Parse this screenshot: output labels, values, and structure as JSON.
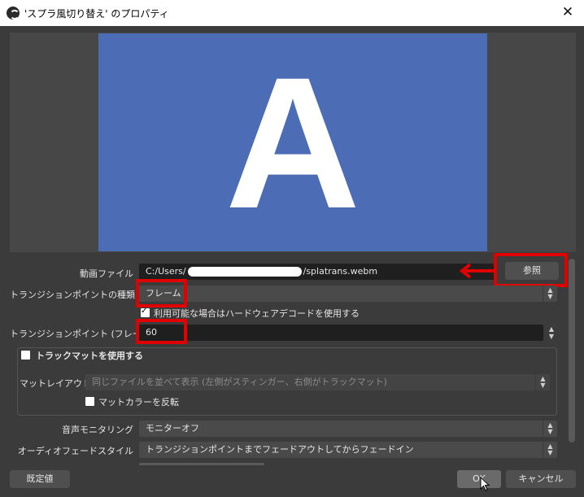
{
  "window": {
    "title": "'スプラ風切り替え' のプロパティ",
    "close_glyph": "✕"
  },
  "preview": {
    "letter": "A",
    "bg_color": "#4c6db5"
  },
  "fields": {
    "video_file_label": "動画ファイル",
    "video_file_prefix": "C:/Users/",
    "video_file_suffix": "/splatrans.webm",
    "browse_label": "参照",
    "transition_point_type_label": "トランジションポイントの種類",
    "transition_point_type_value": "フレーム",
    "hw_decode_label": "利用可能な場合はハードウェアデコードを使用する",
    "hw_decode_checked": true,
    "transition_point_label": "トランジションポイント (フレーム)",
    "transition_point_value": "60"
  },
  "track_matte": {
    "enable_label": "トラックマットを使用する",
    "enabled": false,
    "layout_label": "マットレイアウト",
    "layout_value": "同じファイルを並べて表示 (左側がスティンガー、右側がトラックマット)",
    "invert_label": "マットカラーを反転",
    "invert_checked": false
  },
  "audio": {
    "monitoring_label": "音声モニタリング",
    "monitoring_value": "モニターオフ",
    "fade_style_label": "オーディオフェードスタイル",
    "fade_style_value": "トランジションポイントまでフェードアウトしてからフェードイン"
  },
  "footer": {
    "defaults_label": "既定値",
    "ok_label": "OK",
    "cancel_label": "キャンセル"
  },
  "annotations": {
    "highlight_color": "#e00000"
  }
}
